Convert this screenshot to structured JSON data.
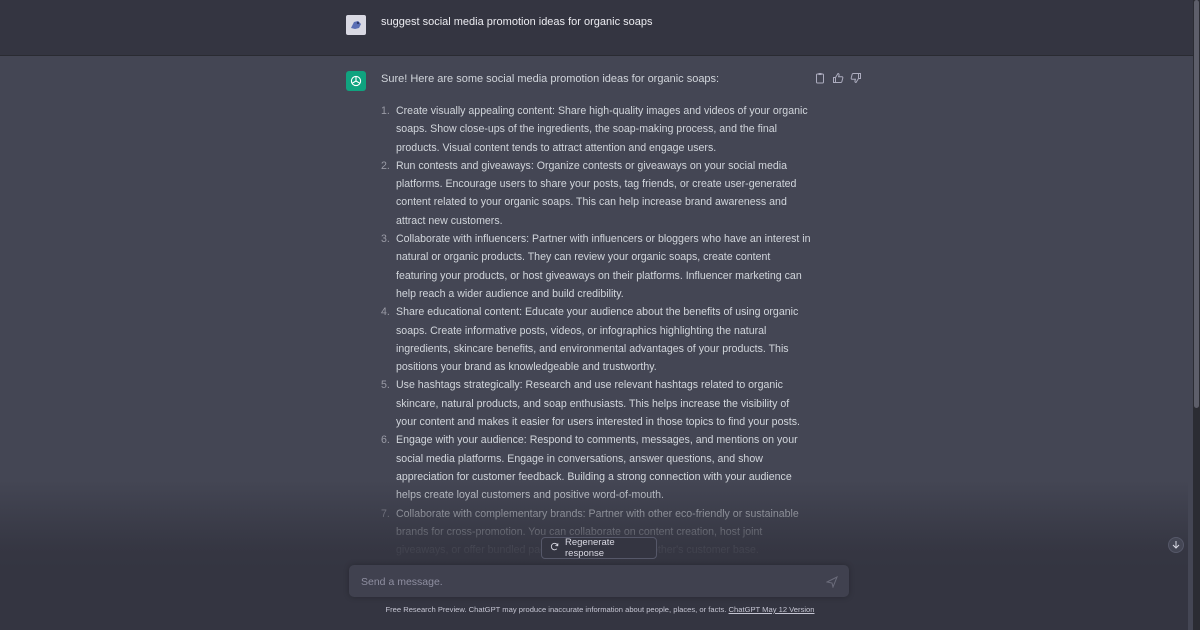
{
  "user_message": {
    "text": "suggest social media promotion ideas for organic soaps",
    "avatar_icon": "user-avatar-icon"
  },
  "assistant_message": {
    "intro": "Sure! Here are some social media promotion ideas for organic soaps:",
    "items": [
      {
        "num": "1.",
        "text": "Create visually appealing content: Share high-quality images and videos of your organic soaps. Show close-ups of the ingredients, the soap-making process, and the final products. Visual content tends to attract attention and engage users."
      },
      {
        "num": "2.",
        "text": "Run contests and giveaways: Organize contests or giveaways on your social media platforms. Encourage users to share your posts, tag friends, or create user-generated content related to your organic soaps. This can help increase brand awareness and attract new customers."
      },
      {
        "num": "3.",
        "text": "Collaborate with influencers: Partner with influencers or bloggers who have an interest in natural or organic products. They can review your organic soaps, create content featuring your products, or host giveaways on their platforms. Influencer marketing can help reach a wider audience and build credibility."
      },
      {
        "num": "4.",
        "text": "Share educational content: Educate your audience about the benefits of using organic soaps. Create informative posts, videos, or infographics highlighting the natural ingredients, skincare benefits, and environmental advantages of your products. This positions your brand as knowledgeable and trustworthy."
      },
      {
        "num": "5.",
        "text": "Use hashtags strategically: Research and use relevant hashtags related to organic skincare, natural products, and soap enthusiasts. This helps increase the visibility of your content and makes it easier for users interested in those topics to find your posts."
      },
      {
        "num": "6.",
        "text": "Engage with your audience: Respond to comments, messages, and mentions on your social media platforms. Engage in conversations, answer questions, and show appreciation for customer feedback. Building a strong connection with your audience helps create loyal customers and positive word-of-mouth."
      },
      {
        "num": "7.",
        "text": "Collaborate with complementary brands: Partner with other eco-friendly or sustainable brands for cross-promotion. You can collaborate on content creation, host joint giveaways, or offer bundled packages to tap into each other's customer base."
      }
    ]
  },
  "regenerate_label": "Regenerate response",
  "input": {
    "placeholder": "Send a message."
  },
  "footer": {
    "text": "Free Research Preview. ChatGPT may produce inaccurate information about people, places, or facts. ",
    "link": "ChatGPT May 12 Version"
  },
  "colors": {
    "accent": "#10a37f",
    "background": "#444654",
    "user_row": "#343541"
  }
}
